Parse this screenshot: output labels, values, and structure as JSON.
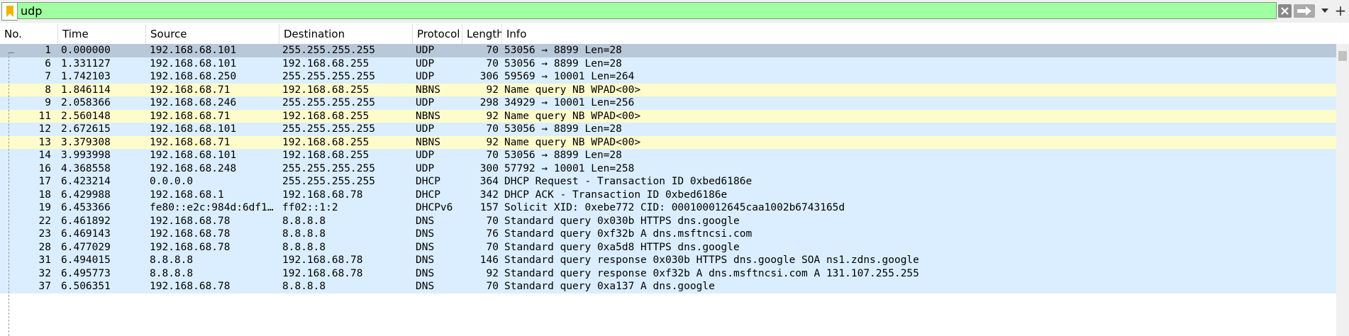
{
  "filter": {
    "value": "udp",
    "add_label": "+"
  },
  "columns": [
    "No.",
    "Time",
    "Source",
    "Destination",
    "Protocol",
    "Length",
    "Info"
  ],
  "colors": {
    "udp": "#daeeff",
    "nbns": "#fffccc",
    "selected": "#b8c8d8"
  },
  "packets": [
    {
      "no": "1",
      "time": "0.000000",
      "src": "192.168.68.101",
      "dst": "255.255.255.255",
      "proto": "UDP",
      "len": "70",
      "info": "53056 → 8899 Len=28",
      "kind": "selected"
    },
    {
      "no": "6",
      "time": "1.331127",
      "src": "192.168.68.101",
      "dst": "192.168.68.255",
      "proto": "UDP",
      "len": "70",
      "info": "53056 → 8899 Len=28",
      "kind": "udp"
    },
    {
      "no": "7",
      "time": "1.742103",
      "src": "192.168.68.250",
      "dst": "255.255.255.255",
      "proto": "UDP",
      "len": "306",
      "info": "59569 → 10001 Len=264",
      "kind": "udp"
    },
    {
      "no": "8",
      "time": "1.846114",
      "src": "192.168.68.71",
      "dst": "192.168.68.255",
      "proto": "NBNS",
      "len": "92",
      "info": "Name query NB WPAD<00>",
      "kind": "nbns"
    },
    {
      "no": "9",
      "time": "2.058366",
      "src": "192.168.68.246",
      "dst": "255.255.255.255",
      "proto": "UDP",
      "len": "298",
      "info": "34929 → 10001 Len=256",
      "kind": "udp"
    },
    {
      "no": "11",
      "time": "2.560148",
      "src": "192.168.68.71",
      "dst": "192.168.68.255",
      "proto": "NBNS",
      "len": "92",
      "info": "Name query NB WPAD<00>",
      "kind": "nbns"
    },
    {
      "no": "12",
      "time": "2.672615",
      "src": "192.168.68.101",
      "dst": "255.255.255.255",
      "proto": "UDP",
      "len": "70",
      "info": "53056 → 8899 Len=28",
      "kind": "udp"
    },
    {
      "no": "13",
      "time": "3.379308",
      "src": "192.168.68.71",
      "dst": "192.168.68.255",
      "proto": "NBNS",
      "len": "92",
      "info": "Name query NB WPAD<00>",
      "kind": "nbns"
    },
    {
      "no": "14",
      "time": "3.993998",
      "src": "192.168.68.101",
      "dst": "192.168.68.255",
      "proto": "UDP",
      "len": "70",
      "info": "53056 → 8899 Len=28",
      "kind": "udp"
    },
    {
      "no": "16",
      "time": "4.368558",
      "src": "192.168.68.248",
      "dst": "255.255.255.255",
      "proto": "UDP",
      "len": "300",
      "info": "57792 → 10001 Len=258",
      "kind": "udp"
    },
    {
      "no": "17",
      "time": "6.423214",
      "src": "0.0.0.0",
      "dst": "255.255.255.255",
      "proto": "DHCP",
      "len": "364",
      "info": "DHCP Request  - Transaction ID 0xbed6186e",
      "kind": "udp"
    },
    {
      "no": "18",
      "time": "6.429988",
      "src": "192.168.68.1",
      "dst": "192.168.68.78",
      "proto": "DHCP",
      "len": "342",
      "info": "DHCP ACK      - Transaction ID 0xbed6186e",
      "kind": "udp"
    },
    {
      "no": "19",
      "time": "6.453366",
      "src": "fe80::e2c:984d:6df1…",
      "dst": "ff02::1:2",
      "proto": "DHCPv6",
      "len": "157",
      "info": "Solicit XID: 0xebe772 CID: 000100012645caa1002b6743165d",
      "kind": "udp"
    },
    {
      "no": "22",
      "time": "6.461892",
      "src": "192.168.68.78",
      "dst": "8.8.8.8",
      "proto": "DNS",
      "len": "70",
      "info": "Standard query 0x030b HTTPS dns.google",
      "kind": "udp"
    },
    {
      "no": "23",
      "time": "6.469143",
      "src": "192.168.68.78",
      "dst": "8.8.8.8",
      "proto": "DNS",
      "len": "76",
      "info": "Standard query 0xf32b A dns.msftncsi.com",
      "kind": "udp"
    },
    {
      "no": "28",
      "time": "6.477029",
      "src": "192.168.68.78",
      "dst": "8.8.8.8",
      "proto": "DNS",
      "len": "70",
      "info": "Standard query 0xa5d8 HTTPS dns.google",
      "kind": "udp"
    },
    {
      "no": "31",
      "time": "6.494015",
      "src": "8.8.8.8",
      "dst": "192.168.68.78",
      "proto": "DNS",
      "len": "146",
      "info": "Standard query response 0x030b HTTPS dns.google SOA ns1.zdns.google",
      "kind": "udp"
    },
    {
      "no": "32",
      "time": "6.495773",
      "src": "8.8.8.8",
      "dst": "192.168.68.78",
      "proto": "DNS",
      "len": "92",
      "info": "Standard query response 0xf32b A dns.msftncsi.com A 131.107.255.255",
      "kind": "udp"
    },
    {
      "no": "37",
      "time": "6.506351",
      "src": "192.168.68.78",
      "dst": "8.8.8.8",
      "proto": "DNS",
      "len": "70",
      "info": "Standard query 0xa137 A dns.google",
      "kind": "udp"
    }
  ]
}
